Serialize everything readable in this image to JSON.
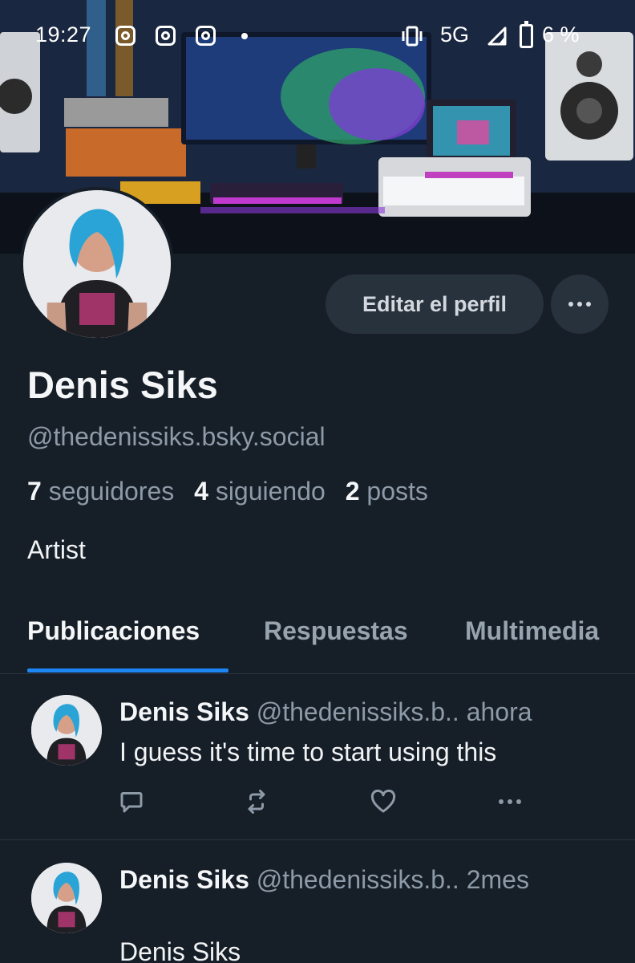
{
  "status_bar": {
    "time": "19:27",
    "network": "5G",
    "battery": "6 %",
    "icons": [
      "instagram-icon",
      "instagram-icon",
      "instagram-icon",
      "vibrate-icon",
      "signal-icon",
      "battery-icon"
    ]
  },
  "profile": {
    "display_name": "Denis Siks",
    "handle": "@thedenissiks.bsky.social",
    "stats": {
      "followers_count": "7",
      "followers_label": "seguidores",
      "following_count": "4",
      "following_label": "siguiendo",
      "posts_count": "2",
      "posts_label": "posts"
    },
    "bio": "Artist",
    "edit_button_label": "Editar el perfil",
    "more_icon": "more-horizontal-icon"
  },
  "tabs": [
    {
      "label": "Publicaciones",
      "active": true
    },
    {
      "label": "Respuestas",
      "active": false
    },
    {
      "label": "Multimedia",
      "active": false
    }
  ],
  "posts": [
    {
      "name": "Denis Siks",
      "handle": "@thedenissiks.b..",
      "time": "ahora",
      "text": "I guess it's time to start using this",
      "actions": [
        "reply-icon",
        "repost-icon",
        "like-icon",
        "more-horizontal-icon"
      ]
    },
    {
      "name": "Denis Siks",
      "handle": "@thedenissiks.b..",
      "time": "2mes",
      "text": "Denis Siks"
    }
  ],
  "colors": {
    "background": "#161e27",
    "accent": "#1d86f4",
    "muted_text": "#8d9aa7",
    "button_bg": "#28323d"
  }
}
